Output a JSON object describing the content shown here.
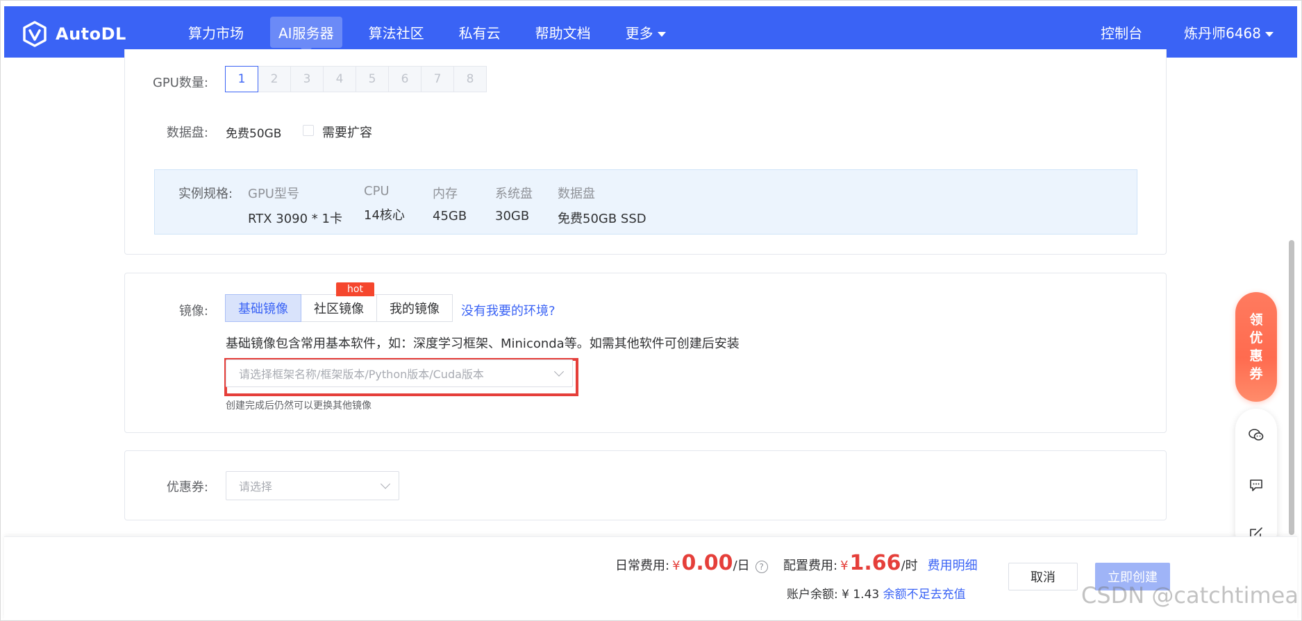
{
  "header": {
    "logo_text": "AutoDL",
    "nav": [
      {
        "label": "算力市场"
      },
      {
        "label": "AI服务器"
      },
      {
        "label": "算法社区"
      },
      {
        "label": "私有云"
      },
      {
        "label": "帮助文档"
      },
      {
        "label": "更多"
      }
    ],
    "console": "控制台",
    "user": "炼丹师6468"
  },
  "gpu": {
    "label": "GPU数量:",
    "options": [
      "1",
      "2",
      "3",
      "4",
      "5",
      "6",
      "7",
      "8"
    ],
    "selected": "1"
  },
  "disk": {
    "label": "数据盘:",
    "value": "免费50GB",
    "expand_label": "需要扩容"
  },
  "spec": {
    "label": "实例规格:",
    "columns": [
      {
        "header": "GPU型号",
        "value": "RTX 3090 * 1卡"
      },
      {
        "header": "CPU",
        "value": "14核心"
      },
      {
        "header": "内存",
        "value": "45GB"
      },
      {
        "header": "系统盘",
        "value": "30GB"
      },
      {
        "header": "数据盘",
        "value": "免费50GB SSD"
      }
    ]
  },
  "image": {
    "label": "镜像:",
    "tabs": [
      "基础镜像",
      "社区镜像",
      "我的镜像"
    ],
    "hot_badge": "hot",
    "no_env_link": "没有我要的环境?",
    "description": "基础镜像包含常用基本软件，如：深度学习框架、Miniconda等。如需其他软件可创建后安装",
    "select_placeholder": "请选择框架名称/框架版本/Python版本/Cuda版本",
    "hint": "创建完成后仍然可以更换其他镜像"
  },
  "coupon": {
    "label": "优惠券:",
    "placeholder": "请选择"
  },
  "footer": {
    "daily_label": "日常费用:",
    "currency": "¥",
    "daily_value": "0.00",
    "daily_unit": "/日",
    "config_label": "配置费用:",
    "config_value": "1.66",
    "config_unit": "/时",
    "fee_detail_link": "费用明细",
    "balance_label": "账户余额:",
    "balance_value": "¥ 1.43",
    "recharge_link": "余额不足去充值",
    "cancel_button": "取消",
    "create_button": "立即创建"
  },
  "float": {
    "coupon_chars": [
      "领",
      "优",
      "惠",
      "券"
    ]
  },
  "watermark": "CSDN @catchtimea",
  "colors": {
    "primary": "#3a63f5",
    "price_red": "#e53f3a",
    "highlight_border": "#e53f3a"
  }
}
